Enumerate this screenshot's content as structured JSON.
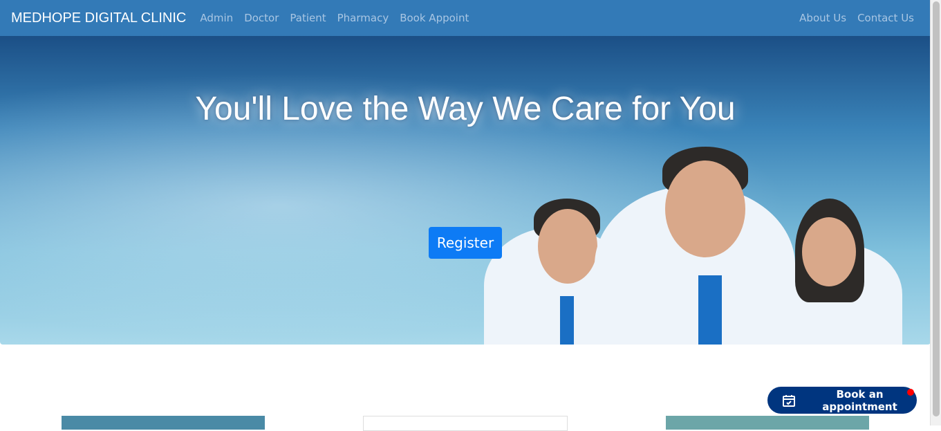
{
  "navbar": {
    "brand": "MEDHOPE DIGITAL CLINIC",
    "links": [
      "Admin",
      "Doctor",
      "Patient",
      "Pharmacy",
      "Book Appoint"
    ],
    "right_links": [
      "About Us",
      "Contact Us"
    ]
  },
  "hero": {
    "title": "You'll Love the Way We Care for You",
    "register_label": "Register"
  },
  "floating": {
    "book_label": "Book an appointment"
  },
  "colors": {
    "navbar": "#337ab7",
    "button": "#0d7bf5",
    "book": "#00357f"
  }
}
